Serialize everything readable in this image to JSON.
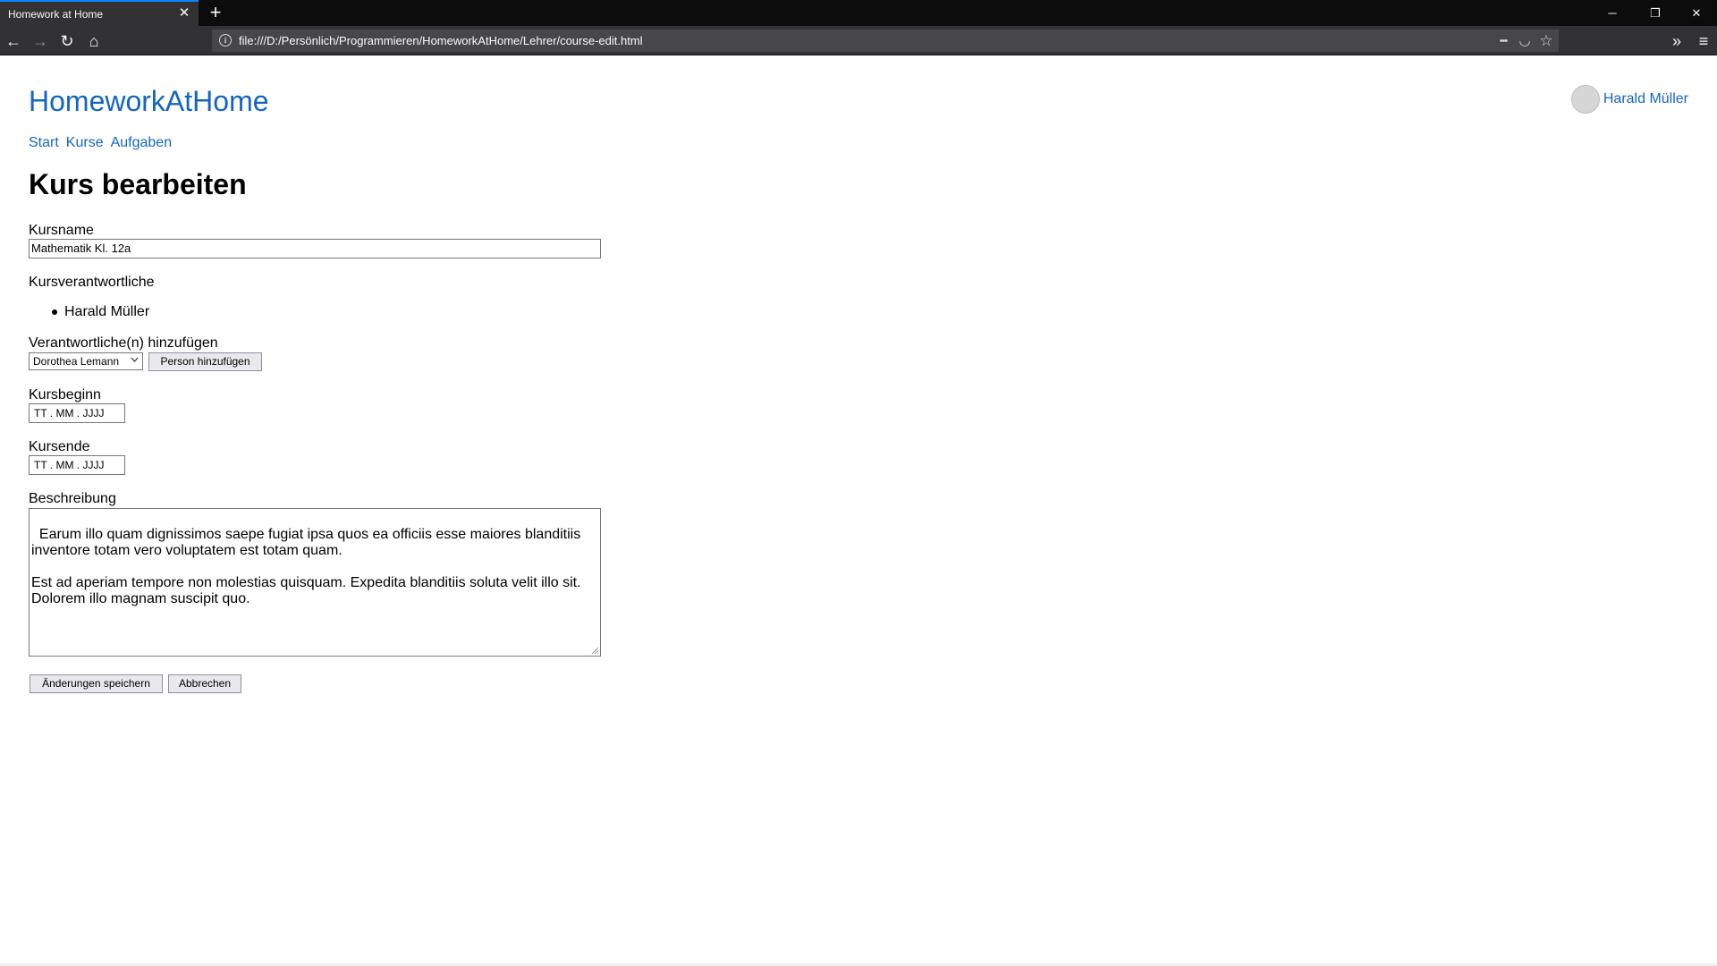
{
  "browser": {
    "tab_title": "Homework at Home",
    "tab_close": "✕",
    "new_tab": "+",
    "url": "file:///D:/Persönlich/Programmieren/HomeworkAtHome/Lehrer/course-edit.html",
    "info": "i",
    "icons": {
      "minimize": "─",
      "restore": "❐",
      "close": "✕",
      "back": "←",
      "forward": "→",
      "reload": "↻",
      "home": "⌂",
      "page_actions": "•••",
      "pocket": "◡",
      "bookmark": "☆",
      "overflow": "»",
      "menu": "≡"
    }
  },
  "site": {
    "title": "HomeworkAtHome",
    "user_name": "Harald Müller",
    "nav": [
      "Start",
      "Kurse",
      "Aufgaben"
    ]
  },
  "form": {
    "page_title": "Kurs bearbeiten",
    "course_name_label": "Kursname",
    "course_name_value": "Mathematik Kl. 12a",
    "owners_label": "Kursverantwortliche",
    "owners": [
      "Harald Müller"
    ],
    "add_owner_label": "Verantwortliche(n) hinzufügen",
    "add_owner_selected": "Dorothea Lemann",
    "add_owner_button": "Person hinzufügen",
    "start_label": "Kursbeginn",
    "start_placeholder": "TT . MM . JJJJ",
    "end_label": "Kursende",
    "end_placeholder": "TT . MM . JJJJ",
    "description_label": "Beschreibung",
    "description": "Earum illo quam dignissimos saepe fugiat ipsa quos ea officiis esse maiores blanditiis inventore totam vero voluptatem est totam quam.\n\nEst ad aperiam tempore non molestias quisquam. Expedita blanditiis soluta velit illo sit. Dolorem illo magnam suscipit quo.",
    "save_button": "Änderungen speichern",
    "cancel_button": "Abbrechen"
  },
  "colors": {
    "link": "#1565c0",
    "chrome_dark": "#0c0c0d",
    "chrome_bar": "#323234",
    "tab_accent": "#0a84ff"
  }
}
